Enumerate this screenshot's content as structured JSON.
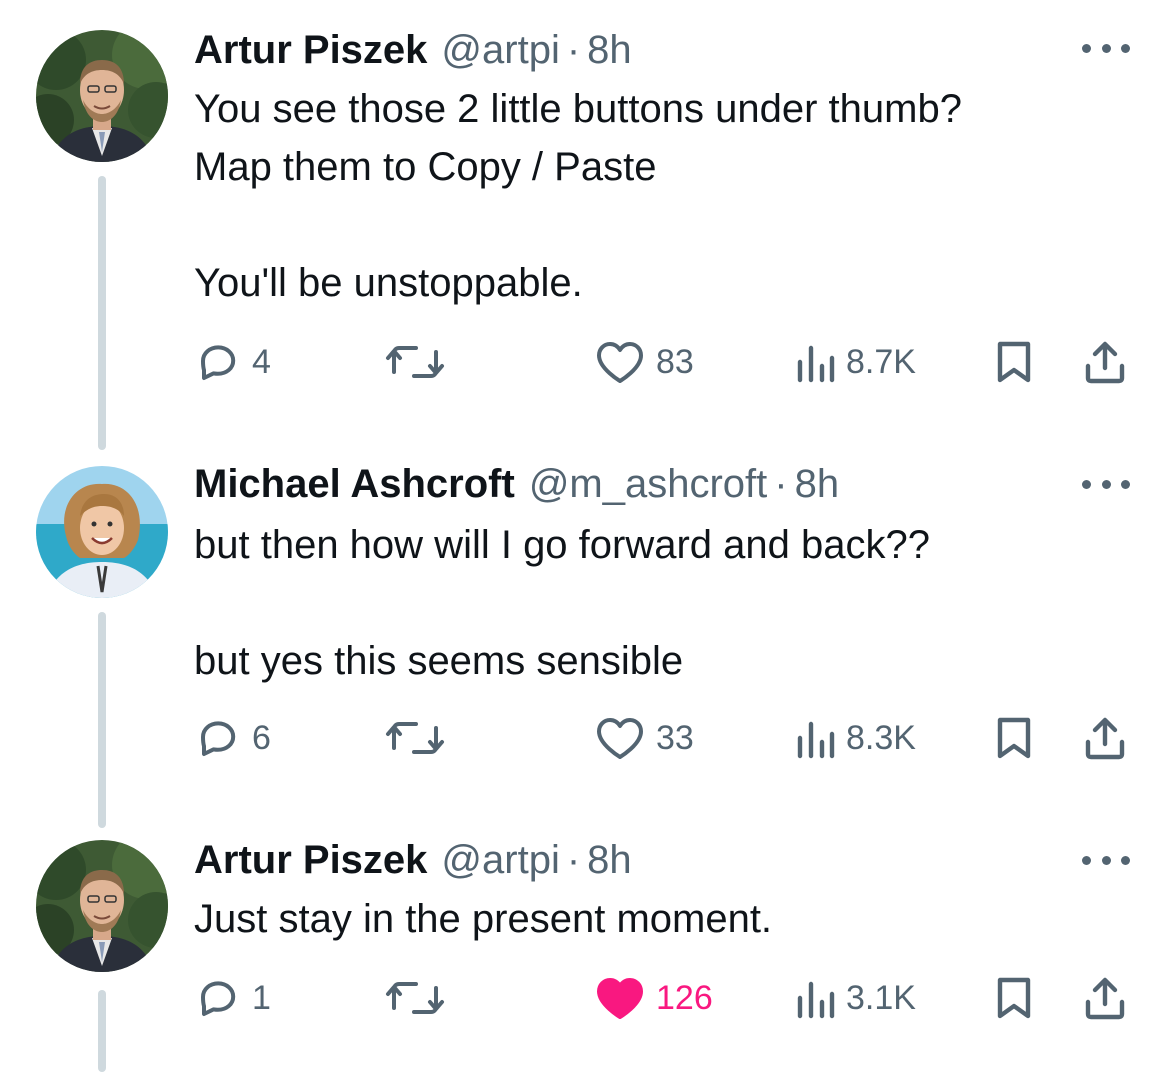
{
  "tweets": [
    {
      "name": "Artur Piszek",
      "handle": "@artpi",
      "separator": "·",
      "time": "8h",
      "text": "You see those 2 little buttons under thumb?\nMap them to Copy / Paste\n\nYou'll be unstoppable.",
      "replies": "4",
      "likes": "83",
      "views": "8.7K",
      "liked": false,
      "avatar": "avatar-man-suit"
    },
    {
      "name": "Michael Ashcroft",
      "handle": "@m_ashcroft",
      "separator": "·",
      "time": "8h",
      "text": "but then how will I go forward and back??\n\nbut yes this seems sensible",
      "replies": "6",
      "likes": "33",
      "views": "8.3K",
      "liked": false,
      "avatar": "avatar-curly-hair-beach"
    },
    {
      "name": "Artur Piszek",
      "handle": "@artpi",
      "separator": "·",
      "time": "8h",
      "text": "Just stay in the present moment.",
      "replies": "1",
      "likes": "126",
      "views": "3.1K",
      "liked": true,
      "avatar": "avatar-man-suit"
    }
  ],
  "colors": {
    "text": "#0f1419",
    "secondary": "#536471",
    "thread_line": "#cfd9de",
    "like_active": "#f91880"
  },
  "icons": [
    "reply-icon",
    "retweet-icon",
    "like-icon",
    "views-icon",
    "bookmark-icon",
    "share-icon",
    "more-icon"
  ]
}
